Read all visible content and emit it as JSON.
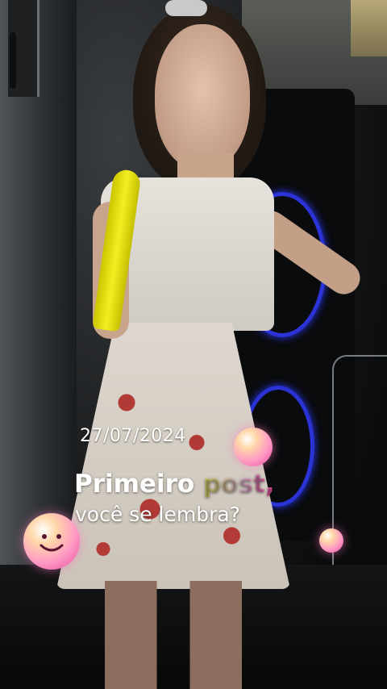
{
  "overlay": {
    "date": "27/07/2024",
    "headline_part1": "Primeiro",
    "headline_part2": "post,",
    "subline": "você se lembra?"
  },
  "colors": {
    "speaker_ring": "#2b33d6",
    "headline_gradient_start": "#f6f27a",
    "headline_gradient_end": "#ff4fa8",
    "bubble": "#ff9ac4",
    "mic": "#f2ee20"
  },
  "icons": {
    "smiley_bubble": "smiling-face-icon",
    "decor_bubble": "bubble-icon"
  }
}
